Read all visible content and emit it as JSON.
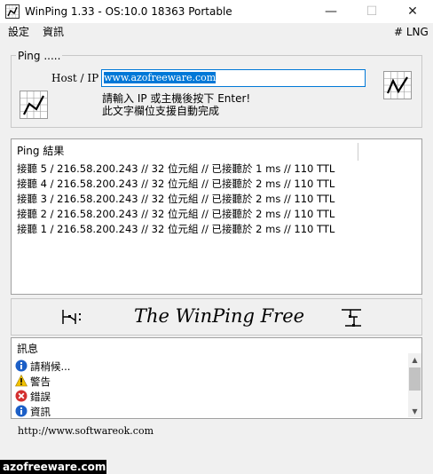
{
  "window": {
    "title": "WinPing 1.33 - OS:10.0 18363 Portable",
    "minimize_glyph": "—",
    "maximize_glyph": "☐",
    "close_glyph": "✕"
  },
  "menu": {
    "settings": "設定",
    "info": "資訊",
    "lng": "# LNG"
  },
  "ping": {
    "group_label": "Ping .....",
    "host_label": "Host / IP :",
    "host_value": "www.azofreeware.com",
    "hint_line1": "請輸入 IP 或主機後按下 Enter!",
    "hint_line2": "此文字欄位支援自動完成"
  },
  "results": {
    "header": "Ping 結果",
    "lines": [
      "接聽 5 / 216.58.200.243  // 32 位元組  // 已接聽於 1 ms // 110 TTL",
      "接聽 4 / 216.58.200.243  // 32 位元組  // 已接聽於 2 ms // 110 TTL",
      "接聽 3 / 216.58.200.243  // 32 位元組  // 已接聽於 2 ms // 110 TTL",
      "接聽 2 / 216.58.200.243  // 32 位元組  // 已接聽於 2 ms // 110 TTL",
      "接聽 1 / 216.58.200.243  // 32 位元組  // 已接聽於 2 ms // 110 TTL"
    ]
  },
  "banner": {
    "text": "The WinPing Free"
  },
  "messages": {
    "header": "訊息",
    "items": [
      {
        "icon": "info-icon",
        "label": "請稍候..."
      },
      {
        "icon": "warning-icon",
        "label": "警告"
      },
      {
        "icon": "error-icon",
        "label": "錯誤"
      },
      {
        "icon": "info-icon",
        "label": "資訊"
      }
    ]
  },
  "footer": {
    "url": "http://www.softwareok.com"
  },
  "watermark": {
    "text": "azofreeware.com"
  },
  "colors": {
    "accent": "#0078d7",
    "info": "#1c5fc7",
    "warning": "#f2c200",
    "error": "#d32f2f"
  }
}
